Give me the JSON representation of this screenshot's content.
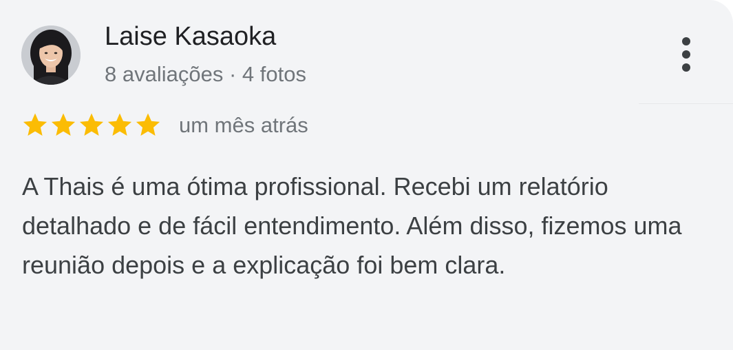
{
  "review": {
    "author_name": "Laise Kasaoka",
    "author_meta": "8 avaliações · 4 fotos",
    "rating": 5,
    "rating_max": 5,
    "star_color": "#fbbc04",
    "time_ago": "um mês atrás",
    "text": "A Thais é uma ótima profissional. Recebi um relatório detalhado e de fácil entendimento. Além disso, fizemos uma reunião depois e a explicação foi bem clara.",
    "menu_icon": "more-vert-icon",
    "avatar_icon": "user-avatar"
  }
}
